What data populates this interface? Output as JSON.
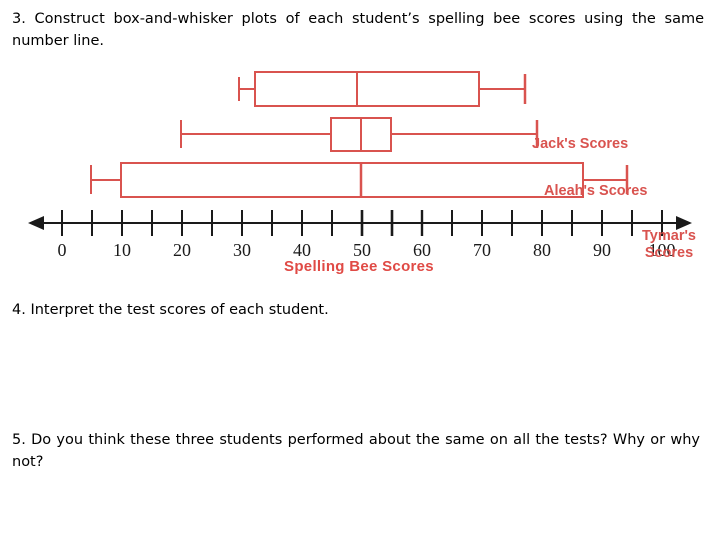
{
  "questions": [
    {
      "id": "q3",
      "text": "3. Construct box-and-whisker plots of each student’s spelling bee scores using the same number line."
    },
    {
      "id": "q4",
      "text": "4. Interpret the test scores of each student."
    },
    {
      "id": "q5",
      "text": "5. Do you think these three students performed about the same on all the tests?  Why or why not?"
    }
  ],
  "labels": {
    "jack": "Jack's Scores",
    "aleah": "Aleah's Scores",
    "tymar": "Tymar's\nScores"
  },
  "colors": {
    "plot_red": "#d9534f",
    "axis_black": "#1a1a1a",
    "text_black": "#000000",
    "axis_title_red": "#e04a45"
  },
  "chart_data": {
    "type": "box",
    "title": "",
    "xlabel": "Spelling Bee Scores",
    "ylabel": "",
    "xlim": [
      0,
      100
    ],
    "grid": false,
    "legend": "right",
    "major_tick_step": 10,
    "minor_tick_step": 5,
    "tick_labels": [
      "0",
      "10",
      "20",
      "30",
      "40",
      "50",
      "60",
      "70",
      "80",
      "90",
      "100"
    ],
    "tick_values": [
      0,
      10,
      20,
      30,
      40,
      50,
      60,
      70,
      80,
      90,
      100
    ],
    "series": [
      {
        "name": "Jack's Scores",
        "min": 29.5,
        "q1": 32,
        "median": 49,
        "q3": 69.5,
        "max": 77
      },
      {
        "name": "Aleah's Scores",
        "min": 20,
        "q1": 45,
        "median": 50,
        "q3": 55,
        "max": 79
      },
      {
        "name": "Tymar's Scores",
        "min": 5,
        "q1": 10,
        "median": 50,
        "q3": 87,
        "max": 94
      }
    ]
  }
}
